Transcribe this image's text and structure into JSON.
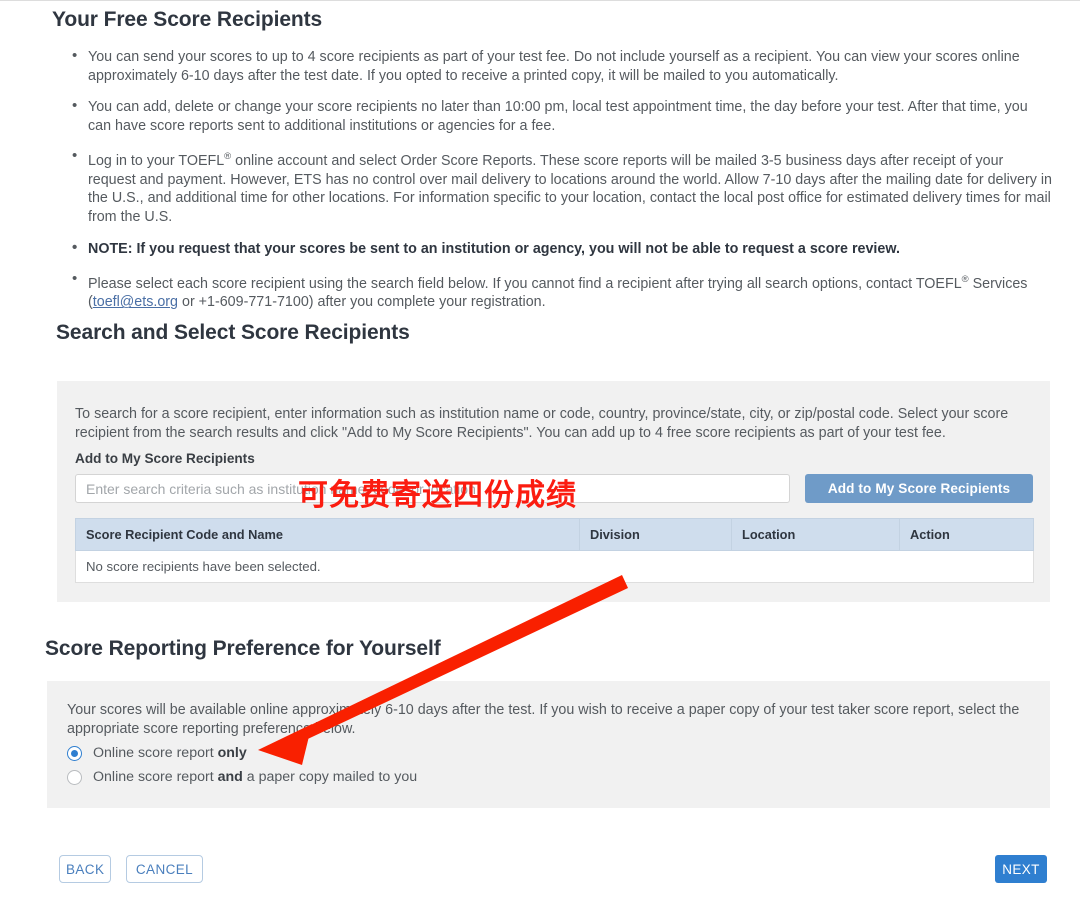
{
  "page": {
    "free_recipients_title": "Your Free Score Recipients",
    "search_select_title": "Search and Select Score Recipients",
    "preference_title": "Score Reporting Preference for Yourself"
  },
  "bullets": [
    "You can send your scores to up to 4 score recipients as part of your test fee. Do not include yourself as a recipient. You can view your scores online approximately 6-10 days after the test date. If you opted to receive a printed copy, it will be mailed to you automatically.",
    "You can add, delete or change your score recipients no later than 10:00 pm, local test appointment time, the day before your test. After that time, you can have score reports sent to additional institutions or agencies for a fee.",
    "Log in to your TOEFL® online account and select Order Score Reports. These score reports will be mailed 3-5 business days after receipt of your request and payment. However, ETS has no control over mail delivery to locations around the world. Allow 7-10 days after the mailing date for delivery in the U.S., and additional time for other locations. For information specific to your location, contact the local post office for estimated delivery times for mail from the U.S.",
    "NOTE: If you request that your scores be sent to an institution or agency, you will not be able to request a score review.",
    "Please select each score recipient using the search field below. If you cannot find a recipient after trying all search options, contact TOEFL® Services (toefl@ets.org or +1-609-771-7100) after you complete your registration."
  ],
  "bullet3": {
    "pre": "Log in to your TOEFL",
    "reg": "®",
    "post": " online account and select Order Score Reports. These score reports will be mailed 3-5 business days after receipt of your request and payment. However, ETS has no control over mail delivery to locations around the world. Allow 7-10 days after the mailing date for delivery in the U.S., and additional time for other locations. For information specific to your location, contact the local post office for estimated delivery times for mail from the U.S."
  },
  "bullet4": {
    "prefix": "NOTE: If you request that your scores be sent to an institution or agency, you will ",
    "emphasis": "not",
    "suffix": " be able to request a score review."
  },
  "bullet5": {
    "pre": "Please select each score recipient using the search field below. If you cannot find a recipient after trying all search options, contact TOEFL",
    "reg": "®",
    "mid": " Services (",
    "email": "toefl@ets.org",
    "post": " or +1-609-771-7100) after you complete your registration."
  },
  "search_panel": {
    "description": "To search for a score recipient, enter information such as institution name or code, country, province/state, city, or zip/postal code. Select your score recipient from the search results and click \"Add to My Score Recipients\". You can add up to 4 free score recipients as part of your test fee.",
    "field_label": "Add to My Score Recipients",
    "input_value": "",
    "input_placeholder": "Enter search criteria such as institution name, code, or location",
    "add_button_label": "Add to My Score Recipients",
    "table": {
      "headers": [
        "Score Recipient Code and Name",
        "Division",
        "Location",
        "Action"
      ],
      "empty_message": "No score recipients have been selected.",
      "rows": []
    }
  },
  "preference_panel": {
    "description": "Your scores will be available online approximately 6-10 days after the test. If you wish to receive a paper copy of your test taker score report, select the appropriate score reporting preference below.",
    "options": [
      {
        "prefix": "Online score report ",
        "emphasis": "only",
        "suffix": "",
        "selected": true
      },
      {
        "prefix": "Online score report ",
        "emphasis": "and",
        "suffix": " a paper copy mailed to you",
        "selected": false
      }
    ]
  },
  "footer": {
    "back_label": "BACK",
    "cancel_label": "CANCEL",
    "next_label": "NEXT"
  },
  "annotations": {
    "chinese_note": "可免费寄送四份成绩",
    "arrow_color": "#f92000"
  },
  "colors": {
    "accent_blue": "#2f7fd0",
    "button_blue": "#6f9bc8",
    "panel_grey": "#f1f1f1",
    "table_header_blue": "#cfdded",
    "link_blue": "#4a6fa5",
    "heading": "#2f3640",
    "annotation_red": "#fb1c10"
  }
}
